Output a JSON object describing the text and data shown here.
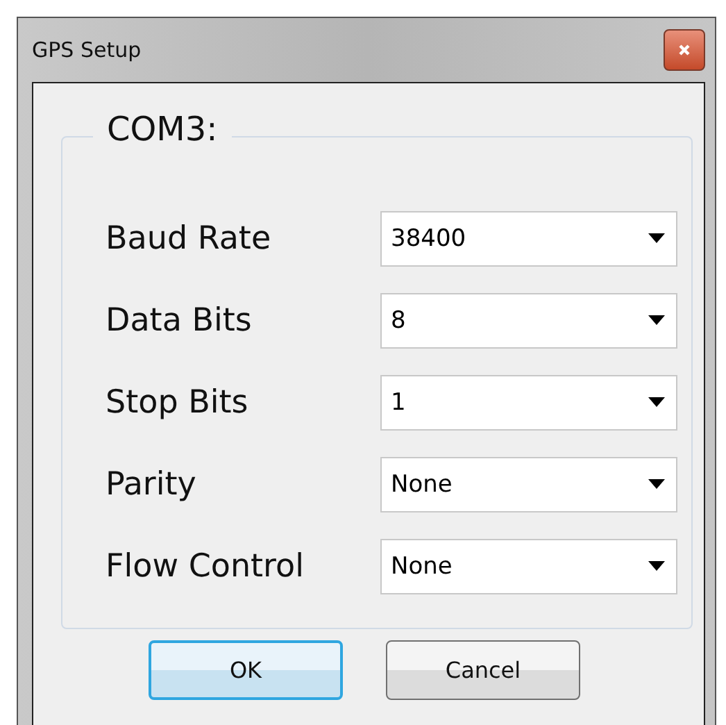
{
  "window": {
    "title": "GPS Setup"
  },
  "group": {
    "title": "COM3:"
  },
  "fields": [
    {
      "label": "Baud Rate",
      "value": "38400"
    },
    {
      "label": "Data Bits",
      "value": "8"
    },
    {
      "label": "Stop Bits",
      "value": "1"
    },
    {
      "label": "Parity",
      "value": "None"
    },
    {
      "label": "Flow Control",
      "value": "None"
    }
  ],
  "buttons": [
    {
      "label": "OK",
      "default": true
    },
    {
      "label": "Cancel",
      "default": false
    }
  ]
}
